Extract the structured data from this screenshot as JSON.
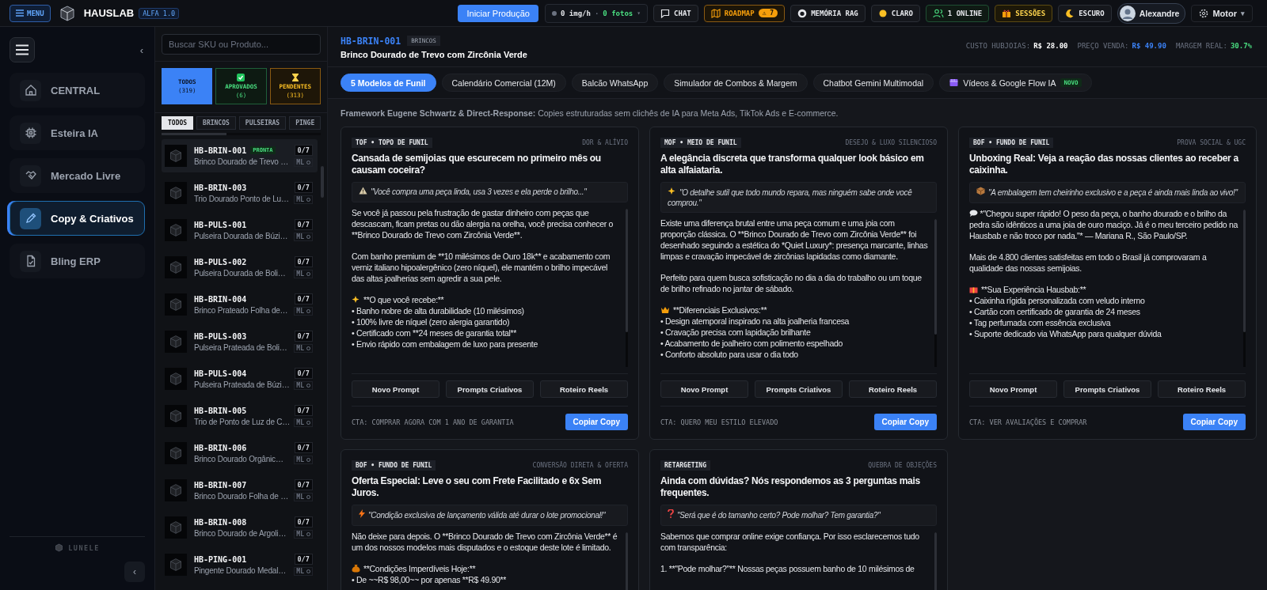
{
  "topbar": {
    "menu_button": "MENU",
    "brand": "HAUSLAB",
    "version": "ALFA 1.0",
    "primary_button": "Iniciar Produção",
    "stats": {
      "rate": "0 img/h",
      "separator": "·",
      "photos": "0 fotos",
      "caret": "▾"
    },
    "buttons": [
      {
        "kind": "chat",
        "label": "CHAT"
      },
      {
        "kind": "roadmap",
        "label": "ROADMAP",
        "badge": "⚠ 7"
      },
      {
        "kind": "memory",
        "label": "MEMÓRIA RAG"
      },
      {
        "kind": "light",
        "label": "CLARO"
      },
      {
        "kind": "online",
        "label": "1 ONLINE"
      },
      {
        "kind": "sessions",
        "label": "SESSÕES"
      },
      {
        "kind": "dark",
        "label": "ESCURO"
      }
    ],
    "user": "Alexandre",
    "engine": {
      "label": "Motor",
      "caret": "▾"
    }
  },
  "sidebar": {
    "collapse": "‹",
    "nav": [
      {
        "label": "CENTRAL",
        "selected": false
      },
      {
        "label": "Esteira IA",
        "selected": false
      },
      {
        "label": "Mercado Livre",
        "selected": false
      },
      {
        "label": "Copy & Criativos",
        "selected": true
      },
      {
        "label": "Bling ERP",
        "selected": false
      }
    ],
    "footer_brand": "LUNELE",
    "footer_collapse": "‹"
  },
  "products": {
    "search": {
      "placeholder": "Buscar SKU ou Produto..."
    },
    "filters": [
      {
        "kind": "all",
        "label": "TODOS",
        "count": "(319)",
        "selected": true
      },
      {
        "kind": "approved",
        "label": "APROVADOS",
        "count": "(6)",
        "selected": false
      },
      {
        "kind": "pending",
        "label": "PENDENTES",
        "count": "(313)",
        "selected": false
      }
    ],
    "categories": [
      {
        "label": "TODOS",
        "selected": true
      },
      {
        "label": "BRINCOS",
        "selected": false
      },
      {
        "label": "PULSEIRAS",
        "selected": false
      },
      {
        "label": "PINGE",
        "selected": false
      }
    ],
    "items": [
      {
        "sku": "HB-BRIN-001",
        "badge": "PRONTA",
        "name": "Brinco Dourado de Trevo …",
        "count": "0/7",
        "channel": "ML",
        "selected": true
      },
      {
        "sku": "HB-BRIN-003",
        "name": "Trio Dourado Ponto de Lu…",
        "count": "0/7",
        "channel": "ML",
        "selected": false
      },
      {
        "sku": "HB-PULS-001",
        "name": "Pulseira Dourada de Búzi…",
        "count": "0/7",
        "channel": "ML",
        "selected": false
      },
      {
        "sku": "HB-PULS-002",
        "name": "Pulseira Dourada de Boli…",
        "count": "0/7",
        "channel": "ML",
        "selected": false
      },
      {
        "sku": "HB-BRIN-004",
        "name": "Brinco Prateado Folha de…",
        "count": "0/7",
        "channel": "ML",
        "selected": false
      },
      {
        "sku": "HB-PULS-003",
        "name": "Pulseira Prateada de Boli…",
        "count": "0/7",
        "channel": "ML",
        "selected": false
      },
      {
        "sku": "HB-PULS-004",
        "name": "Pulseira Prateada de Búzi…",
        "count": "0/7",
        "channel": "ML",
        "selected": false
      },
      {
        "sku": "HB-BRIN-005",
        "name": "Trio de Ponto de Luz de C…",
        "count": "0/7",
        "channel": "ML",
        "selected": false
      },
      {
        "sku": "HB-BRIN-006",
        "name": "Brinco Dourado Orgânic…",
        "count": "0/7",
        "channel": "ML",
        "selected": false
      },
      {
        "sku": "HB-BRIN-007",
        "name": "Brinco Dourado Folha de …",
        "count": "0/7",
        "channel": "ML",
        "selected": false
      },
      {
        "sku": "HB-BRIN-008",
        "name": "Brinco Dourado de Argoli…",
        "count": "0/7",
        "channel": "ML",
        "selected": false
      },
      {
        "sku": "HB-PING-001",
        "name": "Pingente Dourado Medal…",
        "count": "0/7",
        "channel": "ML",
        "selected": false
      }
    ]
  },
  "header": {
    "sku": "HB-BRIN-001",
    "category": "BRINCOS",
    "title": "Brinco Dourado de Trevo com Zircônia Verde",
    "metrics": [
      {
        "kind": "cost",
        "label": "CUSTO HUBJOIAS:",
        "value": "R$ 28.00"
      },
      {
        "kind": "price",
        "label": "PREÇO VENDA:",
        "value": "R$ 49.90"
      },
      {
        "kind": "margin",
        "label": "MARGEM REAL:",
        "value": "30.7%"
      }
    ]
  },
  "tabs": [
    {
      "label": "5 Modelos de Funil",
      "selected": true
    },
    {
      "label": "Calendário Comercial (12M)",
      "selected": false
    },
    {
      "label": "Balcão WhatsApp",
      "selected": false
    },
    {
      "label": "Simulador de Combos & Margem",
      "selected": false
    },
    {
      "label": "Chatbot Gemini Multimodal",
      "selected": false
    },
    {
      "label": "Vídeos & Google Flow IA",
      "badge": "NOVO",
      "selected": false
    }
  ],
  "framework": "**Framework Eugene Schwartz & Direct-Response:** Copies estruturadas sem clichês de IA para Meta Ads, TikTok Ads e E-commerce.",
  "cards": [
    {
      "tag": "TOF • TOPO DE FUNIL",
      "angle": "DOR & ALÍVIO",
      "title": "Cansada de semijoias que escurecem no primeiro mês ou causam coceira?",
      "quote": "\"Você compra uma peça linda, usa 3 vezes e ela perde o brilho...\"",
      "body": [
        {
          "kind": "text",
          "text": "Se você já passou pela frustração de gastar dinheiro com peças que descascam, ficam pretas ou dão alergia na orelha, você precisa conhecer o **Brinco Dourado de Trevo com Zircônia Verde**."
        },
        {
          "kind": "text",
          "text": "Com banho premium de **10 milésimos de Ouro 18k** e acabamento com verniz italiano hipoalergênico (zero níquel), ele mantém o brilho impecável das altas joalherias sem agredir a sua pele."
        },
        {
          "kind": "list",
          "heading": "**O que você recebe:**",
          "items": [
            "• Banho nobre de alta durabilidade (10 milésimos)",
            "• 100% livre de níquel (zero alergia garantido)",
            "• Certificado com **24 meses de garantia total**",
            "• Envio rápido com embalagem de luxo para presente"
          ]
        }
      ],
      "actions": [
        "Novo Prompt",
        "Prompts Criativos",
        "Roteiro Reels"
      ],
      "cta": "CTA: COMPRAR AGORA COM 1 ANO DE GARANTIA",
      "copy_button": "Copiar Copy"
    },
    {
      "tag": "MOF • MEIO DE FUNIL",
      "angle": "DESEJO & LUXO SILENCIOSO",
      "title": "A elegância discreta que transforma qualquer look básico em alta alfaiataria.",
      "quote": "\"O detalhe sutil que todo mundo repara, mas ninguém sabe onde você comprou.\"",
      "body": [
        {
          "kind": "text",
          "text": "Existe uma diferença brutal entre uma peça comum e uma joia com proporção clássica. O **Brinco Dourado de Trevo com Zircônia Verde** foi desenhado seguindo a estética do *Quiet Luxury*: presença marcante, linhas limpas e cravação impecável de zircônias lapidadas como diamante."
        },
        {
          "kind": "text",
          "text": "Perfeito para quem busca sofisticação no dia a dia do trabalho ou um toque de brilho refinado no jantar de sábado."
        },
        {
          "kind": "list",
          "heading": "**Diferenciais Exclusivos:**",
          "items": [
            "• Design atemporal inspirado na alta joalheria francesa",
            "• Cravação precisa com lapidação brilhante",
            "• Acabamento de joalheiro com polimento espelhado",
            "• Conforto absoluto para usar o dia todo"
          ]
        }
      ],
      "actions": [
        "Novo Prompt",
        "Prompts Criativos",
        "Roteiro Reels"
      ],
      "cta": "CTA: QUERO MEU ESTILO ELEVADO",
      "copy_button": "Copiar Copy"
    },
    {
      "tag": "BOF • FUNDO DE FUNIL",
      "angle": "PROVA SOCIAL & UGC",
      "title": "Unboxing Real: Veja a reação das nossas clientes ao receber a caixinha.",
      "quote": "\"A embalagem tem cheirinho exclusivo e a peça é ainda mais linda ao vivo!\"",
      "body": [
        {
          "kind": "testimonial",
          "text": "*\"Chegou super rápido! O peso da peça, o banho dourado e o brilho da pedra são idênticos a uma joia de ouro maciço. Já é o meu terceiro pedido na Hausbab e não troco por nada.\"* — Mariana R., São Paulo/SP."
        },
        {
          "kind": "text",
          "text": "Mais de 4.800 clientes satisfeitas em todo o Brasil já comprovaram a qualidade das nossas semijoias."
        },
        {
          "kind": "list",
          "heading": "**Sua Experiência Hausbab:**",
          "items": [
            "• Caixinha rígida personalizada com veludo interno",
            "• Cartão com certificado de garantia de 24 meses",
            "• Tag perfumada com essência exclusiva",
            "• Suporte dedicado via WhatsApp para qualquer dúvida"
          ]
        }
      ],
      "actions": [
        "Novo Prompt",
        "Prompts Criativos",
        "Roteiro Reels"
      ],
      "cta": "CTA: VER AVALIAÇÕES E COMPRAR",
      "copy_button": "Copiar Copy"
    },
    {
      "tag": "BOF • FUNDO DE FUNIL",
      "angle": "CONVERSÃO DIRETA & OFERTA",
      "title": "Oferta Especial: Leve o seu com Frete Facilitado e 6x Sem Juros.",
      "quote": "\"Condição exclusiva de lançamento válida até durar o lote promocional!\"",
      "body": [
        {
          "kind": "text",
          "text": "Não deixe para depois. O **Brinco Dourado de Trevo com Zircônia Verde** é um dos nossos modelos mais disputados e o estoque deste lote é limitado."
        },
        {
          "kind": "list",
          "heading": "**Condições Imperdíveis Hoje:**",
          "items": [
            "• De ~~R$ 98,00~~ por apenas **R$ 49.90**"
          ]
        }
      ]
    },
    {
      "tag": "RETARGETING",
      "angle": "QUEBRA DE OBJEÇÕES",
      "title": "Ainda com dúvidas? Nós respondemos as 3 perguntas mais frequentes.",
      "quote": "\"Será que é do tamanho certo? Pode molhar? Tem garantia?\"",
      "body": [
        {
          "kind": "text",
          "text": "Sabemos que comprar online exige confiança. Por isso esclarecemos tudo com transparência:"
        },
        {
          "kind": "text",
          "text": "1. **\"Pode molhar?\"** Nossas peças possuem banho de 10 milésimos de"
        }
      ]
    }
  ]
}
